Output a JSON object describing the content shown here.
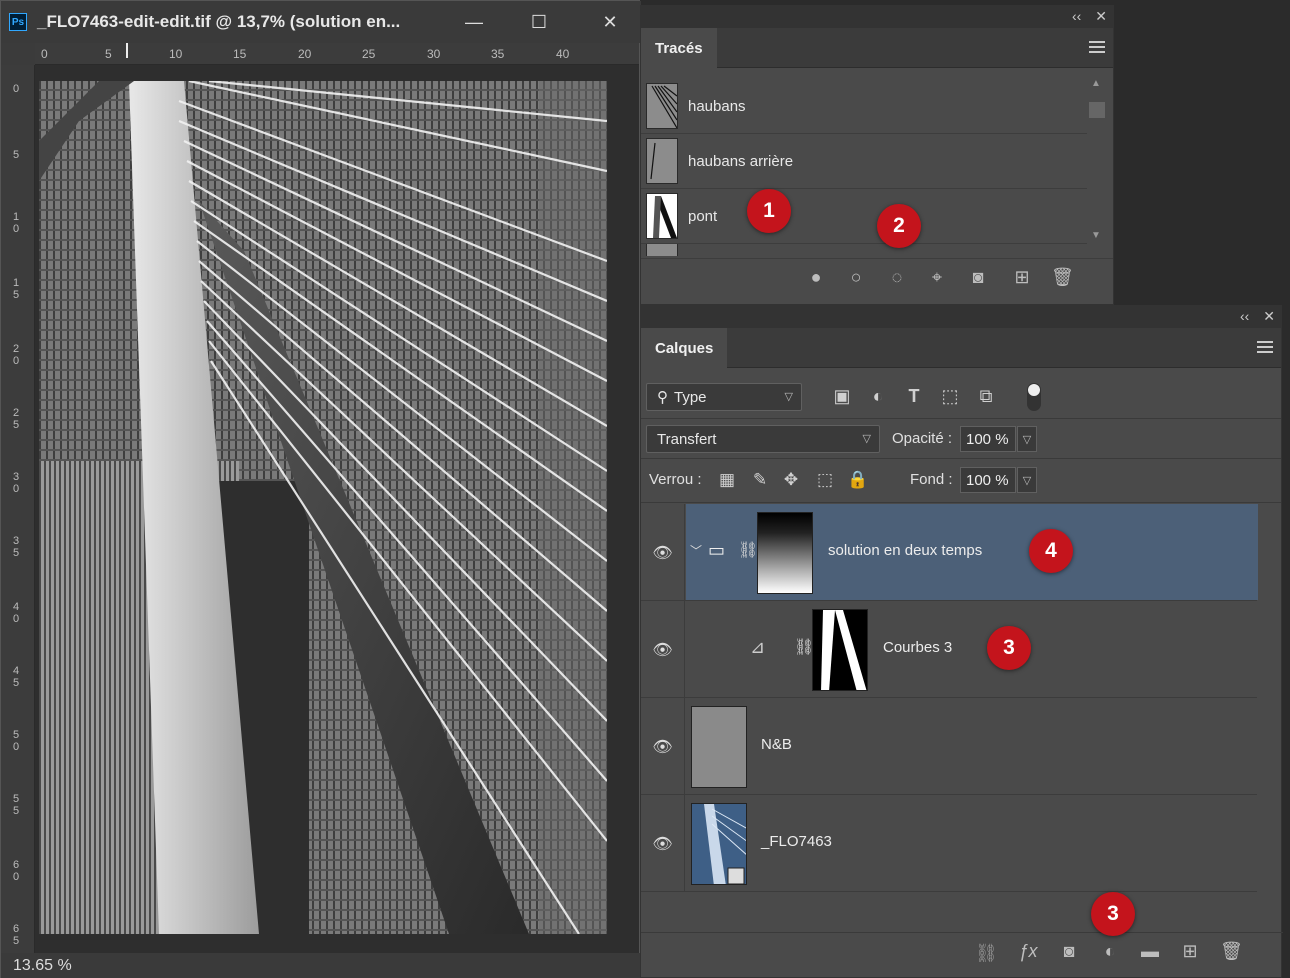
{
  "document": {
    "title": "_FLO7463-edit-edit.tif @ 13,7% (solution en...",
    "app_badge": "Ps",
    "window_controls": {
      "minimize": "—",
      "maximize": "☐",
      "close": "✕"
    },
    "ruler_top_labels": [
      "0",
      "5",
      "10",
      "15",
      "20",
      "25",
      "30",
      "35",
      "40"
    ],
    "ruler_left_labels": [
      "0",
      "5",
      "10",
      "15",
      "20",
      "25",
      "30",
      "35",
      "40",
      "45",
      "50",
      "55",
      "60",
      "65"
    ],
    "zoom_status": "13.65 %"
  },
  "paths_panel": {
    "tab": "Tracés",
    "strip_icons": {
      "collapse": "‹‹",
      "close": "✕"
    },
    "paths": [
      {
        "label": "haubans"
      },
      {
        "label": "haubans arrière"
      },
      {
        "label": "pont"
      }
    ],
    "footer_icons": [
      "fill-path-icon",
      "stroke-path-icon",
      "load-selection-icon",
      "make-path-icon",
      "add-mask-icon",
      "new-path-icon",
      "delete-icon"
    ]
  },
  "layers_panel": {
    "tab": "Calques",
    "strip_icons": {
      "collapse": "‹‹",
      "close": "✕"
    },
    "filter": {
      "selected": "Type"
    },
    "blend_mode": "Transfert",
    "opacity_label": "Opacité :",
    "opacity_value": "100 %",
    "lock_label": "Verrou :",
    "fill_label": "Fond :",
    "fill_value": "100 %",
    "layers": [
      {
        "name": "solution en deux temps",
        "kind": "group",
        "selected": true
      },
      {
        "name": "Courbes 3",
        "kind": "adjustment",
        "selected": false
      },
      {
        "name": "N&B",
        "kind": "pixel",
        "selected": false
      },
      {
        "name": "_FLO7463",
        "kind": "smart-object",
        "selected": false
      }
    ]
  },
  "annotations": {
    "badge_1": "1",
    "badge_2": "2",
    "badge_3_layer": "3",
    "badge_3_footer": "3",
    "badge_4": "4"
  }
}
